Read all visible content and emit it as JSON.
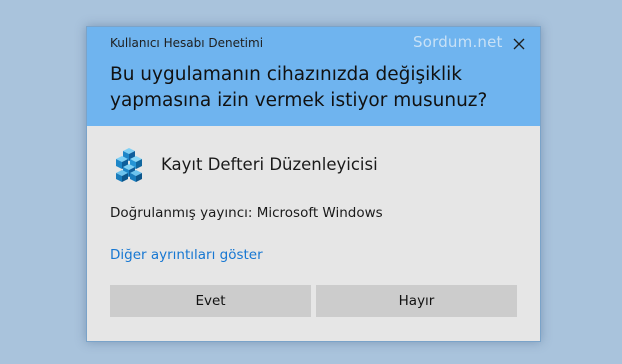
{
  "dialog": {
    "title": "Kullanıcı Hesabı Denetimi",
    "watermark": "Sordum.net",
    "question": "Bu uygulamanın cihazınızda değişiklik yapmasına izin vermek istiyor musunuz?",
    "app": {
      "name": "Kayıt Defteri Düzenleyicisi",
      "icon": "registry-editor-icon"
    },
    "publisher": "Doğrulanmış yayıncı: Microsoft Windows",
    "details_link": "Diğer ayrıntıları göster",
    "buttons": {
      "yes": "Evet",
      "no": "Hayır"
    },
    "colors": {
      "header": "#6fb4ef",
      "body": "#e6e6e6",
      "button": "#cccccc",
      "link": "#1677d2",
      "desktop": "#a9c3dc"
    }
  }
}
